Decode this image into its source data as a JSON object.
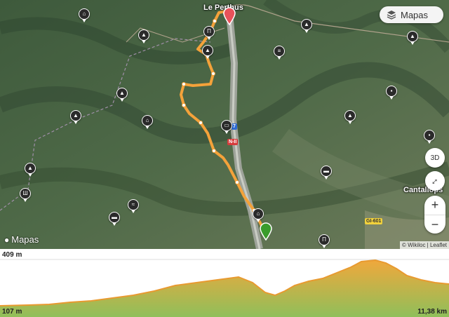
{
  "map": {
    "places": [
      {
        "name": "Le Perthus"
      },
      {
        "name": "Cantallops"
      }
    ],
    "roads": [
      "N-II",
      "GI-601"
    ],
    "markers": {
      "start": {
        "icon": "green-start-pin-icon",
        "color": "#3a9c2c"
      },
      "end": {
        "icon": "red-end-pin-icon",
        "color": "#e8525a"
      }
    },
    "track_color": "#f4a23a",
    "poi_icons": [
      "cave-icon",
      "monument-icon",
      "bridge-icon",
      "hut-icon",
      "picnic-icon",
      "church-icon",
      "signpost-icon",
      "mountain-pass-icon",
      "house-icon",
      "waterfall-icon",
      "ruins-icon",
      "summit-icon",
      "fountain-icon",
      "bed-icon",
      "castle-icon",
      "viewpoint-icon",
      "gate-icon",
      "bus-icon"
    ]
  },
  "controls": {
    "layers_label": "Mapas",
    "three_d_label": "3D",
    "zoom_in": "+",
    "zoom_out": "−",
    "compass": "↕"
  },
  "branding": {
    "logo_text": "Mapas",
    "attribution": "© Wikiloc | Leaflet"
  },
  "profile": {
    "max_elevation_label": "409 m",
    "min_elevation_label": "107 m",
    "distance_label": "11,38 km",
    "fill_color_top": "#f0a83c",
    "fill_color_bottom": "#8fbf5a"
  }
}
